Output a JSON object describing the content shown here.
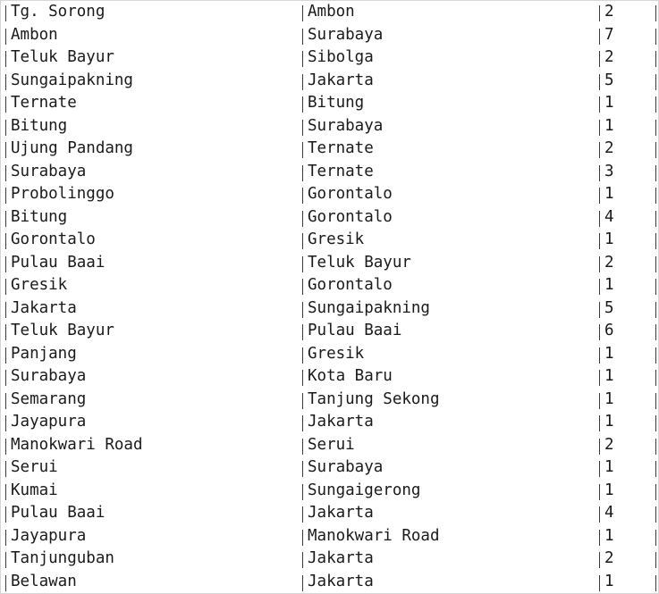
{
  "table": {
    "rows": [
      [
        "Tg. Sorong",
        "Ambon",
        "2"
      ],
      [
        "Ambon",
        "Surabaya",
        "7"
      ],
      [
        "Teluk Bayur",
        "Sibolga",
        "2"
      ],
      [
        "Sungaipakning",
        "Jakarta",
        "5"
      ],
      [
        "Ternate",
        "Bitung",
        "1"
      ],
      [
        "Bitung",
        "Surabaya",
        "1"
      ],
      [
        "Ujung Pandang",
        "Ternate",
        "2"
      ],
      [
        "Surabaya",
        "Ternate",
        "3"
      ],
      [
        "Probolinggo",
        "Gorontalo",
        "1"
      ],
      [
        "Bitung",
        "Gorontalo",
        "4"
      ],
      [
        "Gorontalo",
        "Gresik",
        "1"
      ],
      [
        "Pulau Baai",
        "Teluk Bayur",
        "2"
      ],
      [
        "Gresik",
        "Gorontalo",
        "1"
      ],
      [
        "Jakarta",
        "Sungaipakning",
        "5"
      ],
      [
        "Teluk Bayur",
        "Pulau Baai",
        "6"
      ],
      [
        "Panjang",
        "Gresik",
        "1"
      ],
      [
        "Surabaya",
        "Kota Baru",
        "1"
      ],
      [
        "Semarang",
        "Tanjung Sekong",
        "1"
      ],
      [
        "Jayapura",
        "Jakarta",
        "1"
      ],
      [
        "Manokwari Road",
        "Serui",
        "2"
      ],
      [
        "Serui",
        "Surabaya",
        "1"
      ],
      [
        "Kumai",
        "Sungaigerong",
        "1"
      ],
      [
        "Pulau Baai",
        "Jakarta",
        "4"
      ],
      [
        "Jayapura",
        "Manokwari Road",
        "1"
      ],
      [
        "Tanjunguban",
        "Jakarta",
        "2"
      ],
      [
        "Belawan",
        "Jakarta",
        "1"
      ]
    ]
  }
}
